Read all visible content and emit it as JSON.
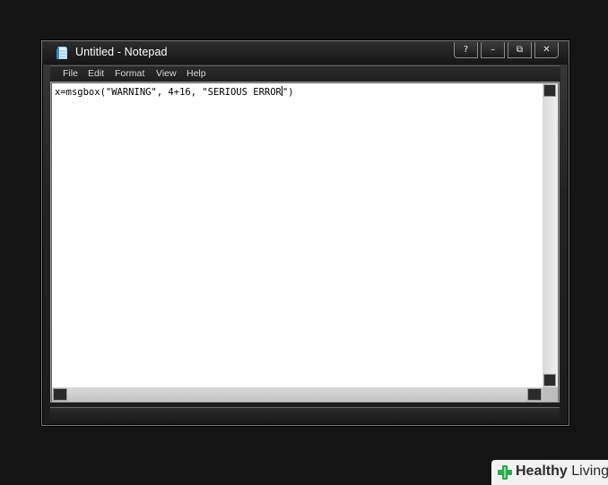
{
  "window": {
    "title": "Untitled - Notepad",
    "controls": {
      "help": "?",
      "minimize": "–",
      "maximize": "⧉",
      "close": "✕"
    }
  },
  "menu": {
    "items": [
      "File",
      "Edit",
      "Format",
      "View",
      "Help"
    ]
  },
  "editor": {
    "text_before_caret": "x=msgbox(\"WARNING\", 4+16, \"SERIOUS ERROR",
    "text_after_caret": "\")"
  },
  "watermark": {
    "bold": "Healthy",
    "regular": " Living"
  },
  "colors": {
    "background": "#141414",
    "window_frame": "#2a2a2a",
    "editor_bg": "#ffffff",
    "watermark_green": "#2fa84f"
  }
}
